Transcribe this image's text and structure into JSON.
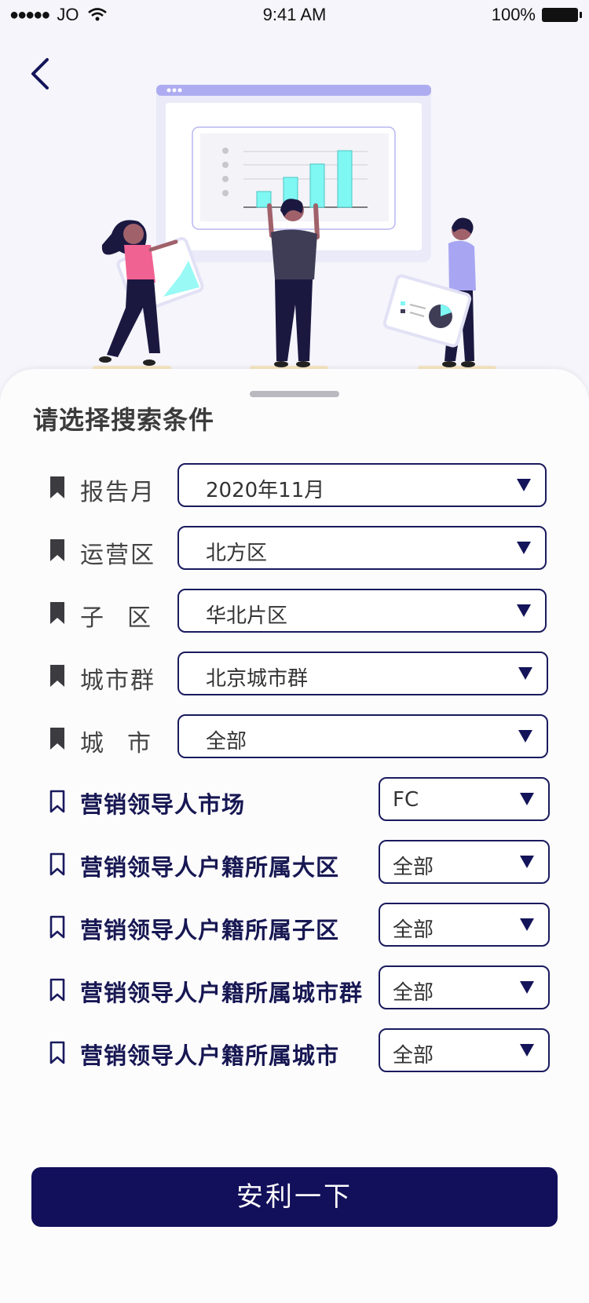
{
  "status_bar": {
    "carrier": "JO",
    "time": "9:41 AM",
    "battery": "100%"
  },
  "title": "请选择搜索条件",
  "filters": [
    {
      "label": "报告月",
      "value": "2020年11月"
    },
    {
      "label": "运营区",
      "value": "北方区"
    },
    {
      "label": "子区",
      "value": "华北片区"
    },
    {
      "label": "城市群",
      "value": "北京城市群"
    },
    {
      "label": "城市",
      "value": "全部"
    }
  ],
  "marketing_filters": [
    {
      "label": "营销领导人市场",
      "value": "FC"
    },
    {
      "label": "营销领导人户籍所属大区",
      "value": "全部"
    },
    {
      "label": "营销领导人户籍所属子区",
      "value": "全部"
    },
    {
      "label": "营销领导人户籍所属城市群",
      "value": "全部"
    },
    {
      "label": "营销领导人户籍所属城市",
      "value": "全部"
    }
  ],
  "submit_label": "安利一下",
  "colors": {
    "primary": "#12105a",
    "accent": "#7ff7f3",
    "panel": "#a8a6f2"
  }
}
